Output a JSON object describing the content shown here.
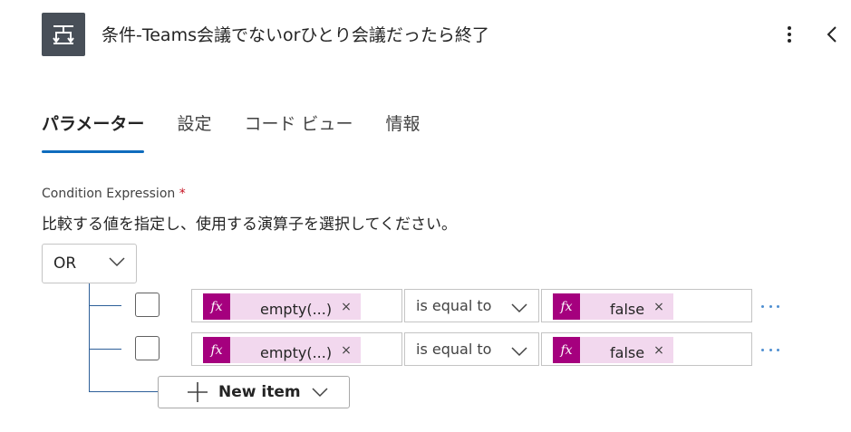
{
  "header": {
    "title": "条件-Teams会議でないorひとり会議だったら終了",
    "action_icon": "condition-icon",
    "more_icon": "more-vertical-icon",
    "collapse_icon": "chevron-left-icon"
  },
  "tabs": [
    {
      "label": "パラメーター",
      "active": true
    },
    {
      "label": "設定",
      "active": false
    },
    {
      "label": "コード ビュー",
      "active": false
    },
    {
      "label": "情報",
      "active": false
    }
  ],
  "condition": {
    "label": "Condition Expression",
    "required_mark": "*",
    "description": "比較する値を指定し、使用する演算子を選択してください。",
    "group_operator": "OR",
    "rows": [
      {
        "left": {
          "fx_label": "fx",
          "text": "empty(...)",
          "remove": "×"
        },
        "operator": "is equal to",
        "right": {
          "fx_label": "fx",
          "text": "false",
          "remove": "×"
        }
      },
      {
        "left": {
          "fx_label": "fx",
          "text": "empty(...)",
          "remove": "×"
        },
        "operator": "is equal to",
        "right": {
          "fx_label": "fx",
          "text": "false",
          "remove": "×"
        }
      }
    ],
    "new_item_label": "New item"
  },
  "colors": {
    "accent": "#0f6cbd",
    "fx_token_bg": "#f2d8ee",
    "fx_badge": "#a5007e",
    "tree_line": "#2d5f99",
    "action_icon_bg": "#484f58"
  }
}
